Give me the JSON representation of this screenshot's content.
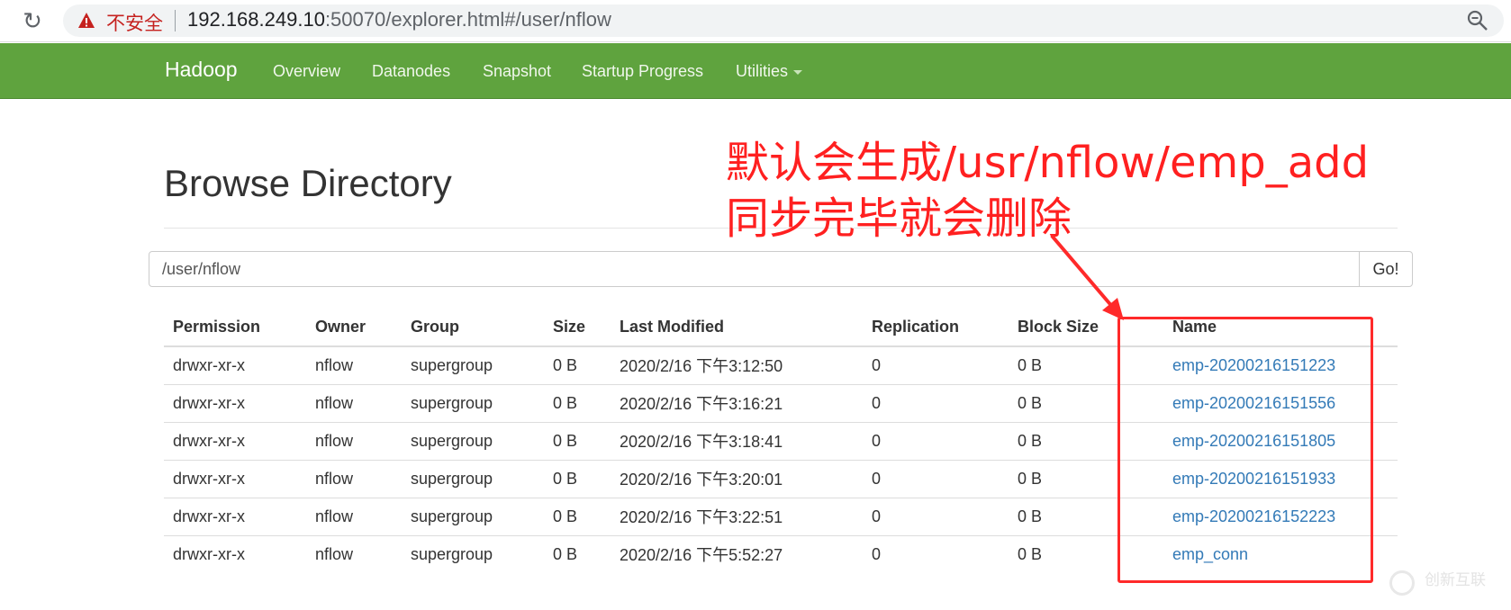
{
  "browser": {
    "security_label": "不安全",
    "url_host": "192.168.249.10",
    "url_rest": ":50070/explorer.html#/user/nflow"
  },
  "navbar": {
    "brand": "Hadoop",
    "items": [
      "Overview",
      "Datanodes",
      "Snapshot",
      "Startup Progress",
      "Utilities"
    ]
  },
  "page": {
    "title": "Browse Directory",
    "path_value": "/user/nflow",
    "go_label": "Go!"
  },
  "annotation": {
    "line1": "默认会生成/usr/nflow/emp_add",
    "line2": "同步完毕就会删除",
    "color": "#ff2020"
  },
  "table": {
    "headers": [
      "Permission",
      "Owner",
      "Group",
      "Size",
      "Last Modified",
      "Replication",
      "Block Size",
      "Name"
    ],
    "rows": [
      [
        "drwxr-xr-x",
        "nflow",
        "supergroup",
        "0 B",
        "2020/2/16 下午3:12:50",
        "0",
        "0 B",
        "emp-20200216151223"
      ],
      [
        "drwxr-xr-x",
        "nflow",
        "supergroup",
        "0 B",
        "2020/2/16 下午3:16:21",
        "0",
        "0 B",
        "emp-20200216151556"
      ],
      [
        "drwxr-xr-x",
        "nflow",
        "supergroup",
        "0 B",
        "2020/2/16 下午3:18:41",
        "0",
        "0 B",
        "emp-20200216151805"
      ],
      [
        "drwxr-xr-x",
        "nflow",
        "supergroup",
        "0 B",
        "2020/2/16 下午3:20:01",
        "0",
        "0 B",
        "emp-20200216151933"
      ],
      [
        "drwxr-xr-x",
        "nflow",
        "supergroup",
        "0 B",
        "2020/2/16 下午3:22:51",
        "0",
        "0 B",
        "emp-20200216152223"
      ],
      [
        "drwxr-xr-x",
        "nflow",
        "supergroup",
        "0 B",
        "2020/2/16 下午5:52:27",
        "0",
        "0 B",
        "emp_conn"
      ]
    ]
  },
  "watermark": "创新互联",
  "colors": {
    "navbar": "#5fa33e",
    "link": "#337ab7",
    "annotation_red": "#ff2a2a"
  },
  "icons": [
    "reload-icon",
    "warning-icon",
    "zoom-icon"
  ]
}
